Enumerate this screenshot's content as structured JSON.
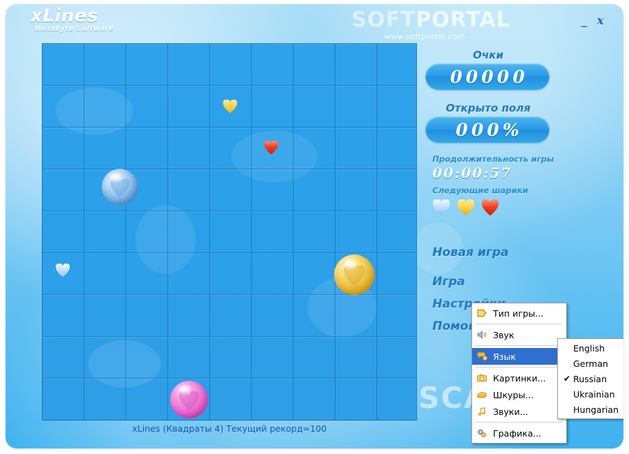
{
  "window": {
    "brand_title": "xLines",
    "brand_subtitle": "WestByte Software",
    "minimize_label": "_",
    "close_label": "x"
  },
  "watermark": {
    "logo_soft": "SOFT",
    "logo_portal": "PORTAL",
    "url": "www.softportal.com",
    "scan": "SCAN"
  },
  "panel": {
    "score_label": "Очки",
    "score_value": "00000",
    "opened_label": "Открыто поля",
    "opened_value": "000%",
    "duration_label": "Продолжительность игры",
    "duration_value": "00:00:57",
    "next_label": "Следующие шарики",
    "next_balls": [
      {
        "name": "next-ball-blue",
        "color": "#b9dcfb"
      },
      {
        "name": "next-ball-yellow",
        "color": "#f5d13f"
      },
      {
        "name": "next-ball-red",
        "color": "#f03b22"
      }
    ]
  },
  "menu": {
    "new_game": "Новая игра",
    "game": "Игра",
    "settings": "Настройки",
    "help": "Помощь"
  },
  "context_menu": {
    "items": [
      {
        "label": "Тип игры...",
        "icon": "play-arrow-icon",
        "selected": false,
        "has_submenu": false
      },
      {
        "label": "Звук",
        "icon": "speaker-icon",
        "selected": false,
        "has_submenu": false
      },
      {
        "label": "Язык",
        "icon": "language-icon",
        "selected": true,
        "has_submenu": true
      },
      {
        "label": "Картинки...",
        "icon": "pictures-icon",
        "selected": false,
        "has_submenu": false
      },
      {
        "label": "Шкуры...",
        "icon": "skins-icon",
        "selected": false,
        "has_submenu": false
      },
      {
        "label": "Звуки...",
        "icon": "music-note-icon",
        "selected": false,
        "has_submenu": false
      },
      {
        "label": "Графика...",
        "icon": "gears-icon",
        "selected": false,
        "has_submenu": false
      }
    ]
  },
  "language_submenu": {
    "items": [
      {
        "label": "English",
        "checked": false
      },
      {
        "label": "German",
        "checked": false
      },
      {
        "label": "Russian",
        "checked": true
      },
      {
        "label": "Ukrainian",
        "checked": false
      },
      {
        "label": "Hungarian",
        "checked": false
      }
    ],
    "check_glyph": "✔"
  },
  "statusbar": {
    "text": "xLines (Квадраты 4) Текущий рекорд=100"
  },
  "board": {
    "columns": 9,
    "rows": 9,
    "cell_size": 60,
    "balls": [
      {
        "name": "ball-blue",
        "kind": "ball",
        "color": "blue",
        "col": 1,
        "row": 2
      },
      {
        "name": "ball-yellow",
        "kind": "ball",
        "color": "yellow",
        "col": 7,
        "row": 5
      },
      {
        "name": "ball-magenta",
        "kind": "ball",
        "color": "magenta",
        "col": 3,
        "row": 8
      }
    ],
    "pending": [
      {
        "name": "mini-heart-yellow",
        "color": "#f3cf45",
        "col": 4,
        "row": 1
      },
      {
        "name": "mini-heart-red",
        "color": "#ef3a21",
        "col": 5,
        "row": 2
      },
      {
        "name": "mini-heart-blue",
        "color": "#bfe0fb",
        "col": 0,
        "row": 5
      }
    ]
  },
  "colors": {
    "window_bg_top": "#a9ddf7",
    "window_bg_bottom": "#3fb2ef",
    "board_bg": "#2ba0e9",
    "accent_label": "#2079bb",
    "pill_bg": "#2a9ae6",
    "menu_highlight": "#2f6fd0"
  }
}
